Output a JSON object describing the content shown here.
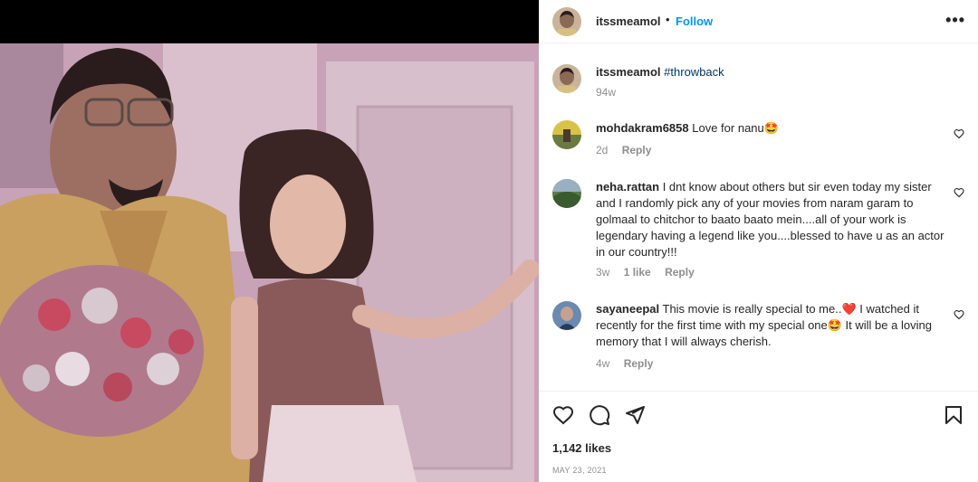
{
  "post": {
    "username": "itssmeamol",
    "follow_label": "Follow",
    "separator": "•",
    "more_label": "•••",
    "likes": "1,142 likes",
    "date": "MAY 23, 2021"
  },
  "caption": {
    "username": "itssmeamol",
    "hashtag": "#throwback",
    "time": "94w"
  },
  "comments": [
    {
      "username": "mohdakram6858",
      "text": "Love for nanu🤩",
      "time": "2d",
      "likes": "",
      "reply": "Reply"
    },
    {
      "username": "neha.rattan",
      "text": "I dnt know about others but sir even today my sister and I randomly pick any of your movies from naram garam to golmaal to chitchor to baato baato mein....all of your work is legendary having a legend like you....blessed to have u as an actor in our country!!!",
      "time": "3w",
      "likes": "1 like",
      "reply": "Reply"
    },
    {
      "username": "sayaneepal",
      "text": "This movie is really special to me..❤️ I watched it recently for the first time with my special one🤩 It will be a loving memory that I will always cherish.",
      "time": "4w",
      "likes": "",
      "reply": "Reply"
    }
  ],
  "icons": {
    "like": "heart-icon",
    "comment": "comment-icon",
    "share": "paper-plane-icon",
    "save": "bookmark-icon",
    "more": "more-options-icon"
  },
  "colors": {
    "accent": "#0095f6",
    "text": "#262626",
    "secondary": "#8e8e8e",
    "hashtag": "#00376b"
  }
}
